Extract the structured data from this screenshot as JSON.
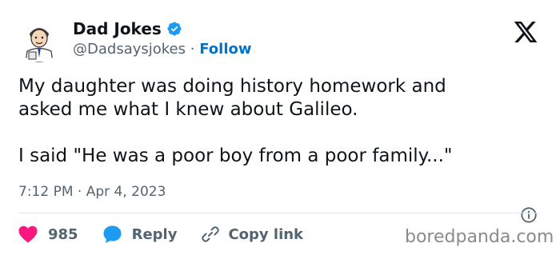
{
  "author": {
    "name": "Dad Jokes",
    "handle": "@Dadsaysjokes",
    "separator": "·",
    "follow_label": "Follow",
    "avatar_icon": "dad-cartoon-avatar",
    "verified_icon": "verified-badge-icon"
  },
  "tweet": {
    "text": "My daughter was doing history homework and\nasked me what I knew about Galileo.\n\nI said \"He was a poor boy from a poor family...\"",
    "timestamp": "7:12 PM · Apr 4, 2023"
  },
  "actions": {
    "like_count": "985",
    "reply_label": "Reply",
    "copy_link_label": "Copy link"
  },
  "watermark": "boredpanda.com",
  "colors": {
    "follow": "#0074c8",
    "like": "#f91880",
    "reply": "#1d9bf0",
    "verified": "#1d9bf0",
    "muted": "#536471"
  }
}
